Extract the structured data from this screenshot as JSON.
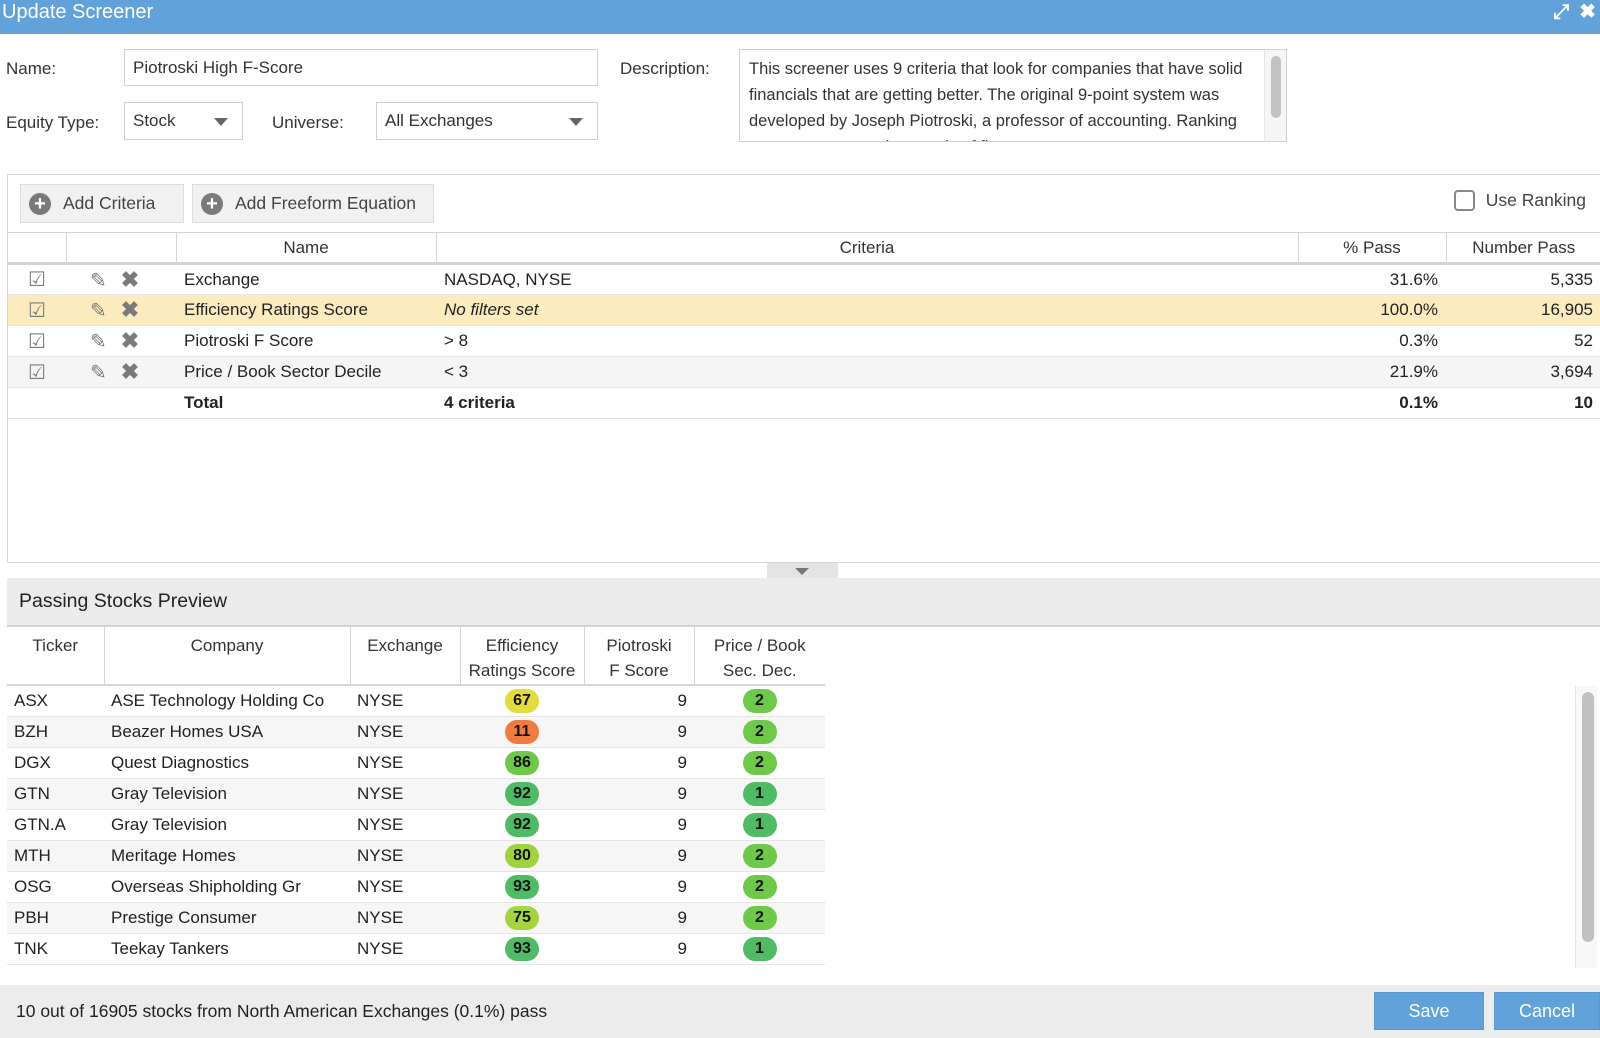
{
  "window": {
    "title": "Update Screener",
    "icons": [
      "expand-icon",
      "close-icon"
    ]
  },
  "form": {
    "name_label": "Name:",
    "name_value": "Piotroski High F-Score",
    "equity_type_label": "Equity Type:",
    "equity_type_value": "Stock",
    "universe_label": "Universe:",
    "universe_value": "All Exchanges",
    "description_label": "Description:",
    "description_value": "This screener uses 9 criteria that look for companies that have solid financials that are getting better. The original 9-point system was developed by Joseph Piotroski, a professor of accounting. Ranking screens rate over thousands of firms..."
  },
  "criteria_toolbar": {
    "add_criteria_label": "Add Criteria",
    "add_freeform_label": "Add Freeform Equation",
    "use_ranking_label": "Use Ranking",
    "use_ranking_checked": false
  },
  "criteria_table": {
    "headers": {
      "name": "Name",
      "criteria": "Criteria",
      "pct_pass": "% Pass",
      "number_pass": "Number Pass"
    },
    "rows": [
      {
        "name": "Exchange",
        "criteria": "NASDAQ, NYSE",
        "pct_pass": "31.6%",
        "number_pass": "5,335",
        "enabled": true
      },
      {
        "name": "Efficiency Ratings Score",
        "criteria": "No filters set",
        "pct_pass": "100.0%",
        "number_pass": "16,905",
        "enabled": true,
        "highlighted": true
      },
      {
        "name": "Piotroski F Score",
        "criteria": "> 8",
        "pct_pass": "0.3%",
        "number_pass": "52",
        "enabled": true
      },
      {
        "name": "Price / Book Sector Decile",
        "criteria": "< 3",
        "pct_pass": "21.9%",
        "number_pass": "3,694",
        "enabled": true
      }
    ],
    "total": {
      "label": "Total",
      "criteria": "4 criteria",
      "pct_pass": "0.1%",
      "number_pass": "10"
    }
  },
  "preview": {
    "title": "Passing Stocks Preview",
    "headers": {
      "ticker": "Ticker",
      "company": "Company",
      "exchange": "Exchange",
      "efficiency_1": "Efficiency",
      "efficiency_2": "Ratings Score",
      "piotroski_1": "Piotroski",
      "piotroski_2": "F Score",
      "pb_1": "Price / Book",
      "pb_2": "Sec. Dec."
    },
    "rows": [
      {
        "ticker": "ASX",
        "company": "ASE Technology Holding Co",
        "exchange": "NYSE",
        "efficiency": "67",
        "eff_color": "#e3dc3c",
        "fscore": "9",
        "pb": "2",
        "pb_color": "#6ec84a"
      },
      {
        "ticker": "BZH",
        "company": "Beazer Homes USA",
        "exchange": "NYSE",
        "efficiency": "11",
        "eff_color": "#f07d3f",
        "fscore": "9",
        "pb": "2",
        "pb_color": "#6ec84a"
      },
      {
        "ticker": "DGX",
        "company": "Quest Diagnostics",
        "exchange": "NYSE",
        "efficiency": "86",
        "eff_color": "#6ec84a",
        "fscore": "9",
        "pb": "2",
        "pb_color": "#6ec84a"
      },
      {
        "ticker": "GTN",
        "company": "Gray Television",
        "exchange": "NYSE",
        "efficiency": "92",
        "eff_color": "#4fbb65",
        "fscore": "9",
        "pb": "1",
        "pb_color": "#4fbb65"
      },
      {
        "ticker": "GTN.A",
        "company": "Gray Television",
        "exchange": "NYSE",
        "efficiency": "92",
        "eff_color": "#4fbb65",
        "fscore": "9",
        "pb": "1",
        "pb_color": "#4fbb65"
      },
      {
        "ticker": "MTH",
        "company": "Meritage Homes",
        "exchange": "NYSE",
        "efficiency": "80",
        "eff_color": "#9fd23e",
        "fscore": "9",
        "pb": "2",
        "pb_color": "#6ec84a"
      },
      {
        "ticker": "OSG",
        "company": "Overseas Shipholding Gr",
        "exchange": "NYSE",
        "efficiency": "93",
        "eff_color": "#4fbb65",
        "fscore": "9",
        "pb": "2",
        "pb_color": "#6ec84a"
      },
      {
        "ticker": "PBH",
        "company": "Prestige Consumer",
        "exchange": "NYSE",
        "efficiency": "75",
        "eff_color": "#a6d43c",
        "fscore": "9",
        "pb": "2",
        "pb_color": "#6ec84a"
      },
      {
        "ticker": "TNK",
        "company": "Teekay Tankers",
        "exchange": "NYSE",
        "efficiency": "93",
        "eff_color": "#4fbb65",
        "fscore": "9",
        "pb": "1",
        "pb_color": "#4fbb65"
      }
    ]
  },
  "footer": {
    "status": "10 out of 16905 stocks from North American Exchanges (0.1%) pass",
    "save_label": "Save",
    "cancel_label": "Cancel"
  },
  "colors": {
    "accent": "#62a2da",
    "highlight_row": "#fcebbf"
  }
}
